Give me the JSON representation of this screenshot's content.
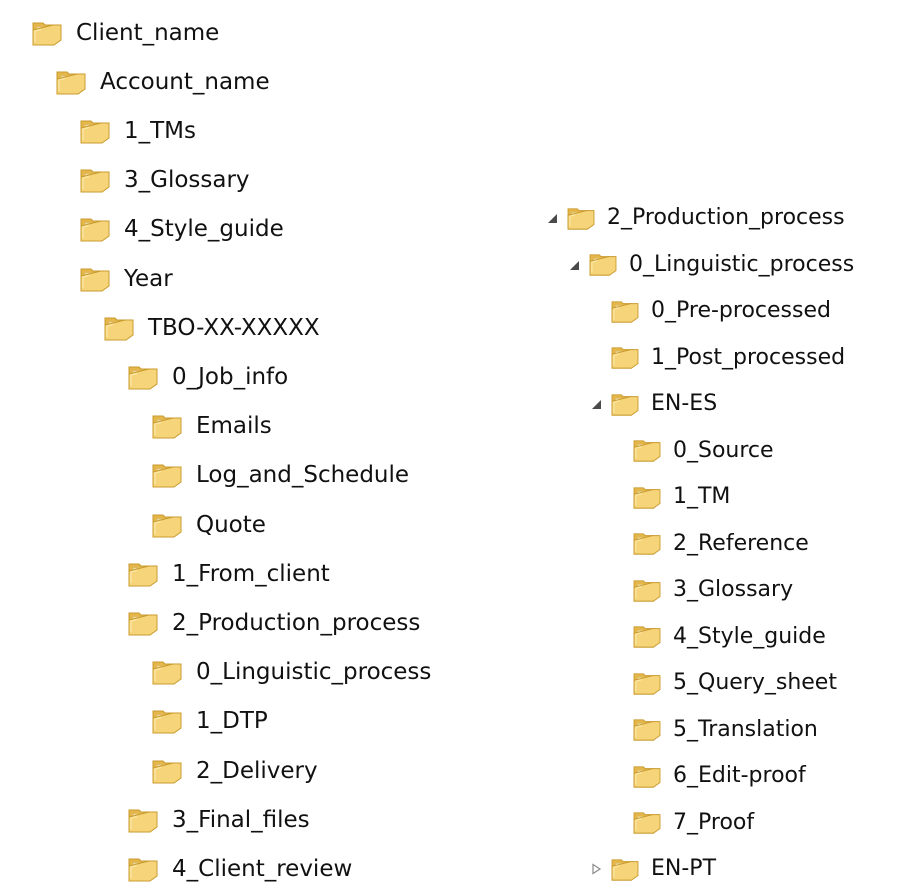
{
  "colors": {
    "folder_front": "#f6d57a",
    "folder_back": "#e5b64a",
    "folder_edge": "#c99a2d",
    "folder_paper": "#fbf1c9",
    "toggle_expanded": "#4a4a4a",
    "toggle_collapsed": "#8a8a8a"
  },
  "icons": {
    "folder": "folder-icon",
    "expanded": "expanded-triangle-icon",
    "collapsed": "collapsed-triangle-icon"
  },
  "left_tree": [
    {
      "label": "Client_name",
      "depth": 0,
      "state": "none"
    },
    {
      "label": "Account_name",
      "depth": 1,
      "state": "none"
    },
    {
      "label": "1_TMs",
      "depth": 2,
      "state": "none"
    },
    {
      "label": "3_Glossary",
      "depth": 2,
      "state": "none"
    },
    {
      "label": "4_Style_guide",
      "depth": 2,
      "state": "none"
    },
    {
      "label": "Year",
      "depth": 2,
      "state": "none"
    },
    {
      "label": "TBO-XX-XXXXX",
      "depth": 3,
      "state": "none"
    },
    {
      "label": "0_Job_info",
      "depth": 4,
      "state": "none"
    },
    {
      "label": "Emails",
      "depth": 5,
      "state": "none"
    },
    {
      "label": "Log_and_Schedule",
      "depth": 5,
      "state": "none"
    },
    {
      "label": "Quote",
      "depth": 5,
      "state": "none"
    },
    {
      "label": "1_From_client",
      "depth": 4,
      "state": "none"
    },
    {
      "label": "2_Production_process",
      "depth": 4,
      "state": "none"
    },
    {
      "label": "0_Linguistic_process",
      "depth": 5,
      "state": "none"
    },
    {
      "label": "1_DTP",
      "depth": 5,
      "state": "none"
    },
    {
      "label": "2_Delivery",
      "depth": 5,
      "state": "none"
    },
    {
      "label": "3_Final_files",
      "depth": 4,
      "state": "none"
    },
    {
      "label": "4_Client_review",
      "depth": 4,
      "state": "none"
    }
  ],
  "right_tree": [
    {
      "label": "2_Production_process",
      "depth": 0,
      "state": "expanded"
    },
    {
      "label": "0_Linguistic_process",
      "depth": 1,
      "state": "expanded"
    },
    {
      "label": "0_Pre-processed",
      "depth": 2,
      "state": "none"
    },
    {
      "label": "1_Post_processed",
      "depth": 2,
      "state": "none"
    },
    {
      "label": "EN-ES",
      "depth": 2,
      "state": "expanded"
    },
    {
      "label": "0_Source",
      "depth": 3,
      "state": "none"
    },
    {
      "label": "1_TM",
      "depth": 3,
      "state": "none"
    },
    {
      "label": "2_Reference",
      "depth": 3,
      "state": "none"
    },
    {
      "label": "3_Glossary",
      "depth": 3,
      "state": "none"
    },
    {
      "label": "4_Style_guide",
      "depth": 3,
      "state": "none"
    },
    {
      "label": "5_Query_sheet",
      "depth": 3,
      "state": "none"
    },
    {
      "label": "5_Translation",
      "depth": 3,
      "state": "none"
    },
    {
      "label": "6_Edit-proof",
      "depth": 3,
      "state": "none"
    },
    {
      "label": "7_Proof",
      "depth": 3,
      "state": "none"
    },
    {
      "label": "EN-PT",
      "depth": 2,
      "state": "collapsed"
    }
  ]
}
